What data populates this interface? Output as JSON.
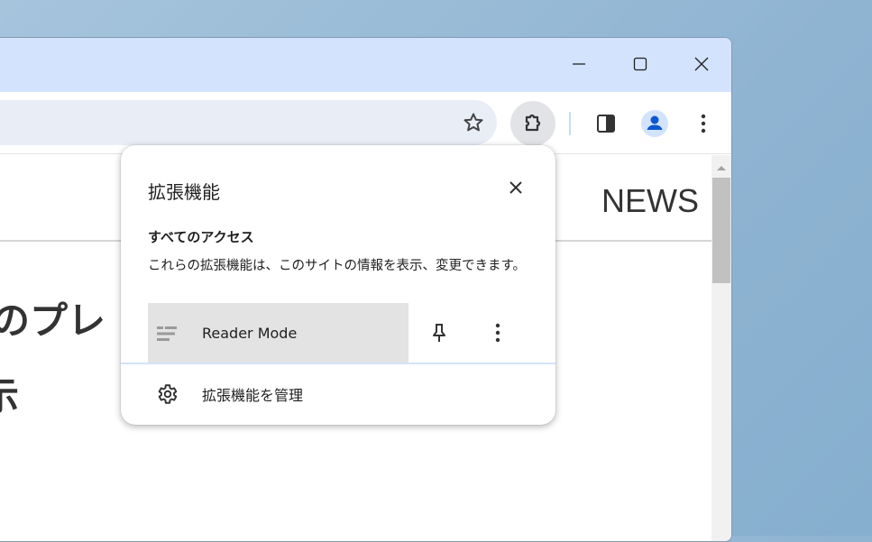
{
  "window": {
    "controls": [
      "minimize",
      "maximize",
      "close"
    ]
  },
  "toolbar": {
    "icons": [
      "star-icon",
      "extensions-icon",
      "side-panel-icon",
      "profile-avatar-icon",
      "menu-icon"
    ],
    "avatar_color": "#0b57d0",
    "titlebar_color": "#d3e3fd"
  },
  "page": {
    "nav_label": "NEWS",
    "headline_fragment": "のプレ",
    "headline_fragment_2": "示"
  },
  "popup": {
    "title": "拡張機能",
    "section_title": "すべてのアクセス",
    "description": "これらの拡張機能は、このサイトの情報を表示、変更できます。",
    "extensions": [
      {
        "name": "Reader Mode",
        "icon": "reader-mode-icon"
      }
    ],
    "manage_label": "拡張機能を管理"
  }
}
